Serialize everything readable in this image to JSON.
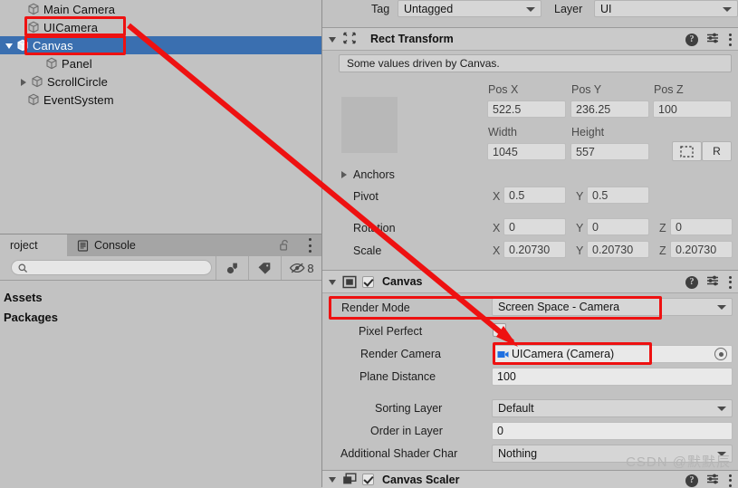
{
  "hierarchy": {
    "items": [
      {
        "label": "Main Camera",
        "depth": 1,
        "expander": "none",
        "selected": false,
        "icon": "gameobject-icon"
      },
      {
        "label": "UICamera",
        "depth": 1,
        "expander": "none",
        "selected": false,
        "icon": "gameobject-icon"
      },
      {
        "label": "Canvas",
        "depth": 1,
        "expander": "open",
        "selected": true,
        "icon": "gameobject-icon"
      },
      {
        "label": "Panel",
        "depth": 2,
        "expander": "none",
        "selected": false,
        "icon": "gameobject-icon"
      },
      {
        "label": "ScrollCircle",
        "depth": 1,
        "expander": "closed",
        "selected": false,
        "icon": "gameobject-icon"
      },
      {
        "label": "EventSystem",
        "depth": 1,
        "expander": "none",
        "selected": false,
        "icon": "gameobject-icon"
      }
    ]
  },
  "project_panel": {
    "tabs": [
      {
        "label": "roject",
        "active": true,
        "icon": ""
      },
      {
        "label": "Console",
        "active": false,
        "icon": "console-icon"
      }
    ],
    "lock_icon": "lock-open-icon",
    "menu_icon": "kebab-menu-icon",
    "search": {
      "value": "",
      "placeholder": "",
      "icon": "search-icon"
    },
    "filters": [
      {
        "name": "filter-by-type-icon"
      },
      {
        "name": "filter-by-label-icon"
      },
      {
        "name": "hidden-items-icon",
        "count": "8"
      }
    ],
    "items": [
      {
        "label": "Assets"
      },
      {
        "label": "Packages"
      }
    ]
  },
  "inspector": {
    "tag": {
      "label": "Tag",
      "value": "Untagged"
    },
    "layer": {
      "label": "Layer",
      "value": "UI"
    },
    "rect_transform": {
      "title": "Rect Transform",
      "notice": "Some values driven by Canvas.",
      "col_labels": [
        "Pos X",
        "Pos Y",
        "Pos Z"
      ],
      "pos": [
        "522.5",
        "236.25",
        "100"
      ],
      "size_labels": [
        "Width",
        "Height"
      ],
      "size": [
        "1045",
        "557"
      ],
      "blueprint_button": "blueprint-mode-icon",
      "raw_button": "R",
      "anchors_label": "Anchors",
      "pivot_label": "Pivot",
      "pivot": {
        "x": "0.5",
        "y": "0.5"
      },
      "rotation_label": "Rotation",
      "rotation": {
        "x": "0",
        "y": "0",
        "z": "0"
      },
      "scale_label": "Scale",
      "scale": {
        "x": "0.20730",
        "y": "0.20730",
        "z": "0.20730"
      },
      "axis_x": "X",
      "axis_y": "Y",
      "axis_z": "Z",
      "help_icon": "help-icon",
      "preset_icon": "preset-icon",
      "menu_icon": "kebab-menu-icon"
    },
    "canvas": {
      "title": "Canvas",
      "enabled": true,
      "rows": [
        {
          "label": "Render Mode",
          "value": "Screen Space - Camera",
          "kind": "dropdown"
        },
        {
          "label": "Pixel Perfect",
          "value": "",
          "kind": "checkbox",
          "checked": false
        },
        {
          "label": "Render Camera",
          "value": "UICamera (Camera)",
          "kind": "object"
        },
        {
          "label": "Plane Distance",
          "value": "100",
          "kind": "text"
        },
        {
          "label": "Sorting Layer",
          "value": "Default",
          "kind": "dropdown"
        },
        {
          "label": "Order in Layer",
          "value": "0",
          "kind": "text"
        },
        {
          "label": "Additional Shader Char",
          "value": "Nothing",
          "kind": "dropdown"
        }
      ]
    },
    "canvas_scaler": {
      "title": "Canvas Scaler",
      "enabled": true
    }
  },
  "annotations": {
    "boxes": [
      "uicamera-hierarchy",
      "canvas-hierarchy",
      "render-mode-row",
      "render-camera-value"
    ],
    "arrow": "red-arrow-uicamera-to-render-camera",
    "color": "#ee1111"
  },
  "watermark": {
    "text": "CSDN @默默辰"
  }
}
